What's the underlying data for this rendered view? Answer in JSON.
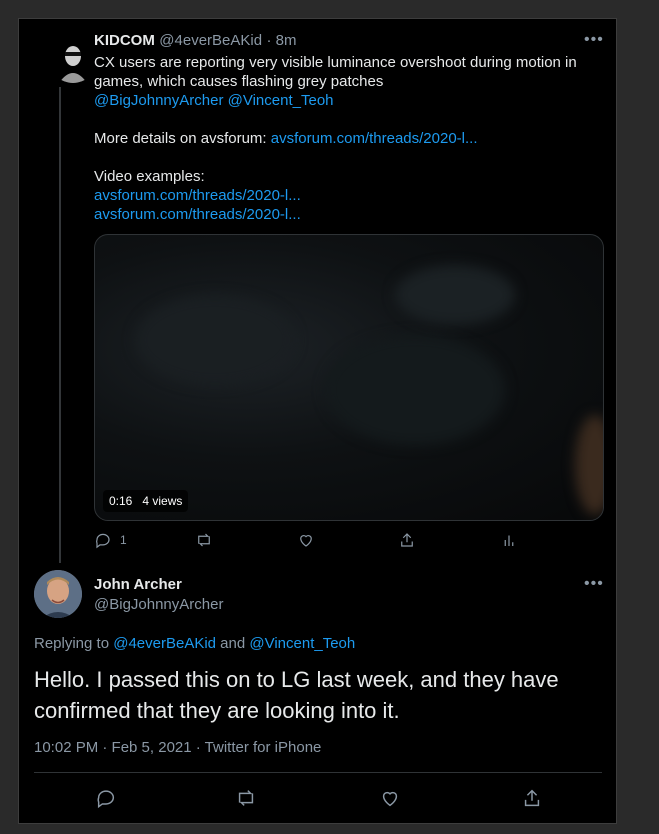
{
  "tweet1": {
    "name": "KIDCOM",
    "handle": "@4everBeAKid",
    "time": "· 8m",
    "text_line1": "CX users are reporting very visible luminance overshoot during motion in",
    "text_line2": "games, which causes flashing grey patches",
    "mention1": "@BigJohnnyArcher",
    "mention2": "@Vincent_Teoh",
    "details_prefix": "More details on avsforum: ",
    "details_link": "avsforum.com/threads/2020-l...",
    "video_label": "Video examples:",
    "video_link1": "avsforum.com/threads/2020-l...",
    "video_link2": "avsforum.com/threads/2020-l...",
    "media_duration": "0:16",
    "media_views": "4 views",
    "reply_count": "1"
  },
  "tweet2": {
    "name": "John Archer",
    "handle": "@BigJohnnyArcher",
    "replying_prefix": "Replying to ",
    "replying_user1": "@4everBeAKid",
    "replying_and": " and ",
    "replying_user2": "@Vincent_Teoh",
    "text_line1": "Hello. I passed this on to LG last week, and they have",
    "text_line2": "confirmed that they are looking into it.",
    "meta": "10:02 PM · Feb 5, 2021 · Twitter for iPhone"
  },
  "icons": {
    "more": "more-icon",
    "reply": "reply-icon",
    "retweet": "retweet-icon",
    "like": "like-icon",
    "share": "share-icon",
    "analytics": "analytics-icon"
  },
  "colors": {
    "background": "#000000",
    "text": "#e7e9ea",
    "secondary": "#8b98a5",
    "link": "#1d9bf0",
    "border": "#2f3336"
  }
}
